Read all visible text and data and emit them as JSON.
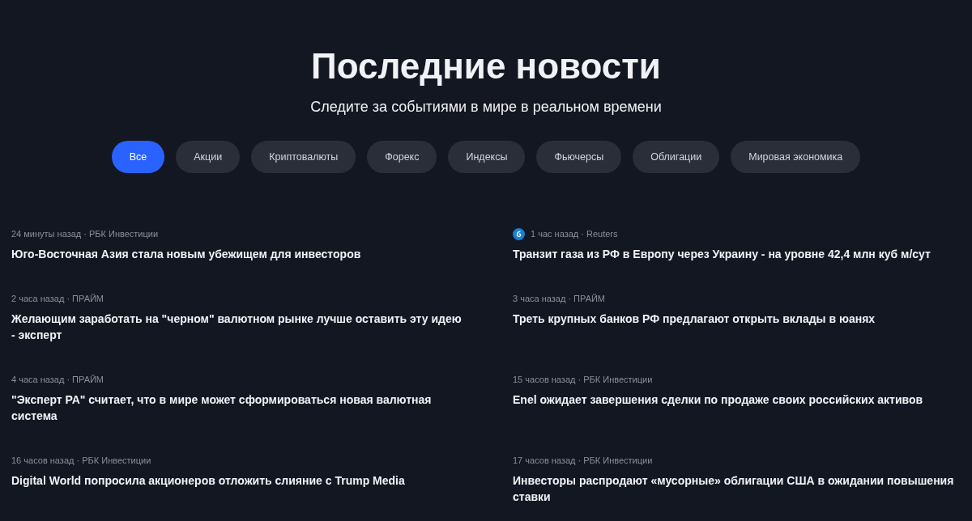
{
  "header": {
    "title": "Последние новости",
    "subtitle": "Следите за событиями в мире в реальном времени"
  },
  "filters": [
    {
      "label": "Все",
      "selected": true
    },
    {
      "label": "Акции",
      "selected": false
    },
    {
      "label": "Криптовалюты",
      "selected": false
    },
    {
      "label": "Форекс",
      "selected": false
    },
    {
      "label": "Индексы",
      "selected": false
    },
    {
      "label": "Фьючерсы",
      "selected": false
    },
    {
      "label": "Облигации",
      "selected": false
    },
    {
      "label": "Мировая экономика",
      "selected": false
    }
  ],
  "news": [
    {
      "meta": "24 минуты назад · РБК Инвестиции",
      "source_icon": false,
      "title": "Юго-Восточная Азия стала новым убежищем для инвесторов"
    },
    {
      "meta": "1 час назад · Reuters",
      "source_icon": true,
      "title": "Транзит газа из РФ в Европу через Украину - на уровне 42,4 млн куб м/сут"
    },
    {
      "meta": "2 часа назад · ПРАЙМ",
      "source_icon": false,
      "title": "Желающим заработать на \"черном\" валютном рынке лучше оставить эту идею - эксперт"
    },
    {
      "meta": "3 часа назад · ПРАЙМ",
      "source_icon": false,
      "title": "Треть крупных банков РФ предлагают открыть вклады в юанях"
    },
    {
      "meta": "4 часа назад · ПРАЙМ",
      "source_icon": false,
      "title": "\"Эксперт РА\" считает, что в мире может сформироваться новая валютная система"
    },
    {
      "meta": "15 часов назад · РБК Инвестиции",
      "source_icon": false,
      "title": "Enel ожидает завершения сделки по продаже своих российских активов"
    },
    {
      "meta": "16 часов назад · РБК Инвестиции",
      "source_icon": false,
      "title": "Digital World попросила акционеров отложить слияние с Trump Media"
    },
    {
      "meta": "17 часов назад · РБК Инвестиции",
      "source_icon": false,
      "title": "Инвесторы распродают «мусорные» облигации США в ожидании повышения ставки"
    }
  ]
}
